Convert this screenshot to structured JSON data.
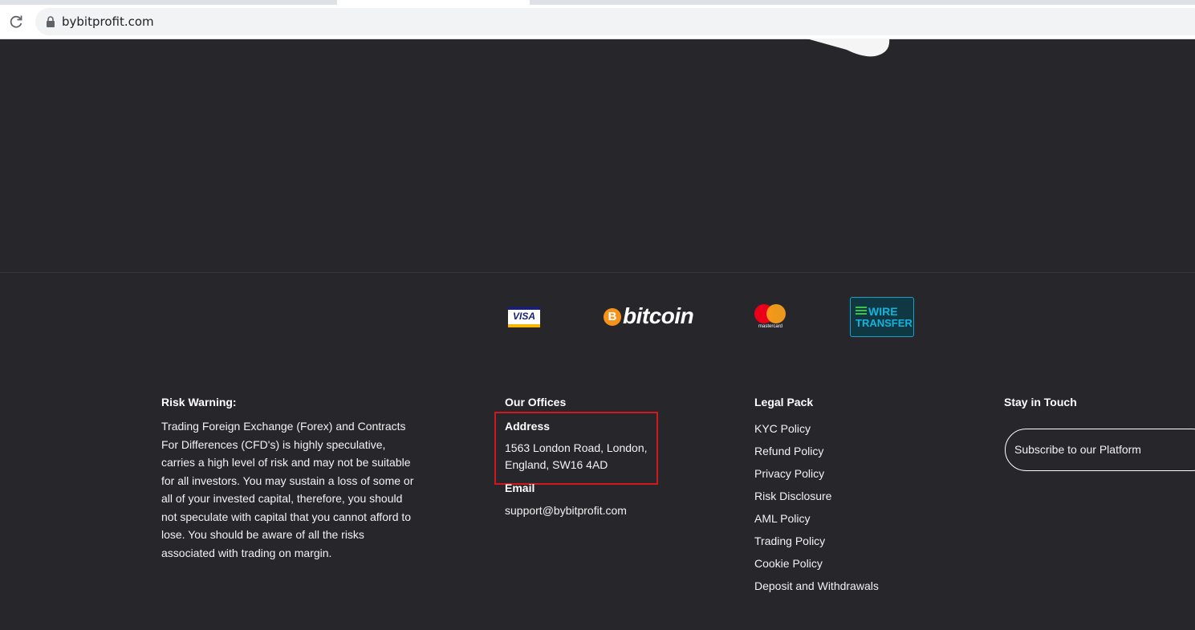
{
  "browser": {
    "url": "bybitprofit.com"
  },
  "payments": {
    "visa": "VISA",
    "bitcoin": "bitcoin",
    "bitcoin_symbol": "B",
    "mastercard": "mastercard",
    "wire_line1": "WIRE",
    "wire_line2": "TRANSFER"
  },
  "footer": {
    "risk": {
      "title": "Risk Warning:",
      "text": "Trading Foreign Exchange (Forex) and Contracts For Differences (CFD's) is highly speculative, carries a high level of risk and may not be suitable for all investors. You may sustain a loss of some or all of your invested capital, therefore, you should not speculate with capital that you cannot afford to lose. You should be aware of all the risks associated with trading on margin."
    },
    "offices": {
      "title": "Our Offices",
      "address_label": "Address",
      "address_line1": "1563 London Road, London,",
      "address_line2": "England, SW16 4AD",
      "email_label": "Email",
      "email": "support@bybitprofit.com"
    },
    "legal": {
      "title": "Legal Pack",
      "items": [
        "KYC Policy",
        "Refund Policy",
        "Privacy Policy",
        "Risk Disclosure",
        "AML Policy",
        "Trading Policy",
        "Cookie Policy",
        "Deposit and Withdrawals"
      ]
    },
    "contact": {
      "title": "Stay in Touch",
      "subscribe_placeholder": "Subscribe to our Platform"
    }
  },
  "colors": {
    "background": "#27262b",
    "highlight_box": "#d0181e",
    "bitcoin_orange": "#f7931a",
    "wire_blue": "#13b3e0"
  }
}
